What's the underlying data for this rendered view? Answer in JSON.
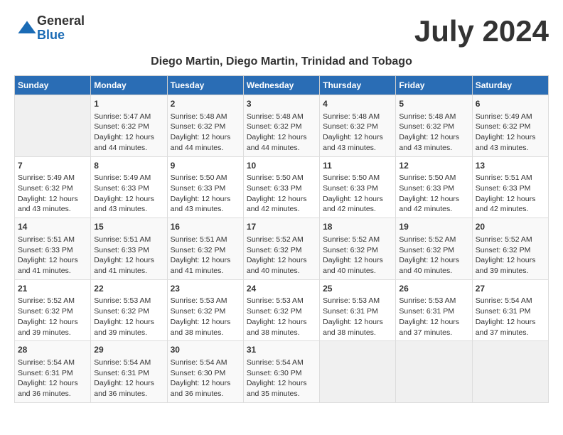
{
  "logo": {
    "general": "General",
    "blue": "Blue"
  },
  "title": "July 2024",
  "subtitle": "Diego Martin, Diego Martin, Trinidad and Tobago",
  "days_of_week": [
    "Sunday",
    "Monday",
    "Tuesday",
    "Wednesday",
    "Thursday",
    "Friday",
    "Saturday"
  ],
  "weeks": [
    [
      {
        "day": "",
        "info": ""
      },
      {
        "day": "1",
        "info": "Sunrise: 5:47 AM\nSunset: 6:32 PM\nDaylight: 12 hours\nand 44 minutes."
      },
      {
        "day": "2",
        "info": "Sunrise: 5:48 AM\nSunset: 6:32 PM\nDaylight: 12 hours\nand 44 minutes."
      },
      {
        "day": "3",
        "info": "Sunrise: 5:48 AM\nSunset: 6:32 PM\nDaylight: 12 hours\nand 44 minutes."
      },
      {
        "day": "4",
        "info": "Sunrise: 5:48 AM\nSunset: 6:32 PM\nDaylight: 12 hours\nand 43 minutes."
      },
      {
        "day": "5",
        "info": "Sunrise: 5:48 AM\nSunset: 6:32 PM\nDaylight: 12 hours\nand 43 minutes."
      },
      {
        "day": "6",
        "info": "Sunrise: 5:49 AM\nSunset: 6:32 PM\nDaylight: 12 hours\nand 43 minutes."
      }
    ],
    [
      {
        "day": "7",
        "info": "Sunrise: 5:49 AM\nSunset: 6:32 PM\nDaylight: 12 hours\nand 43 minutes."
      },
      {
        "day": "8",
        "info": "Sunrise: 5:49 AM\nSunset: 6:33 PM\nDaylight: 12 hours\nand 43 minutes."
      },
      {
        "day": "9",
        "info": "Sunrise: 5:50 AM\nSunset: 6:33 PM\nDaylight: 12 hours\nand 43 minutes."
      },
      {
        "day": "10",
        "info": "Sunrise: 5:50 AM\nSunset: 6:33 PM\nDaylight: 12 hours\nand 42 minutes."
      },
      {
        "day": "11",
        "info": "Sunrise: 5:50 AM\nSunset: 6:33 PM\nDaylight: 12 hours\nand 42 minutes."
      },
      {
        "day": "12",
        "info": "Sunrise: 5:50 AM\nSunset: 6:33 PM\nDaylight: 12 hours\nand 42 minutes."
      },
      {
        "day": "13",
        "info": "Sunrise: 5:51 AM\nSunset: 6:33 PM\nDaylight: 12 hours\nand 42 minutes."
      }
    ],
    [
      {
        "day": "14",
        "info": "Sunrise: 5:51 AM\nSunset: 6:33 PM\nDaylight: 12 hours\nand 41 minutes."
      },
      {
        "day": "15",
        "info": "Sunrise: 5:51 AM\nSunset: 6:33 PM\nDaylight: 12 hours\nand 41 minutes."
      },
      {
        "day": "16",
        "info": "Sunrise: 5:51 AM\nSunset: 6:32 PM\nDaylight: 12 hours\nand 41 minutes."
      },
      {
        "day": "17",
        "info": "Sunrise: 5:52 AM\nSunset: 6:32 PM\nDaylight: 12 hours\nand 40 minutes."
      },
      {
        "day": "18",
        "info": "Sunrise: 5:52 AM\nSunset: 6:32 PM\nDaylight: 12 hours\nand 40 minutes."
      },
      {
        "day": "19",
        "info": "Sunrise: 5:52 AM\nSunset: 6:32 PM\nDaylight: 12 hours\nand 40 minutes."
      },
      {
        "day": "20",
        "info": "Sunrise: 5:52 AM\nSunset: 6:32 PM\nDaylight: 12 hours\nand 39 minutes."
      }
    ],
    [
      {
        "day": "21",
        "info": "Sunrise: 5:52 AM\nSunset: 6:32 PM\nDaylight: 12 hours\nand 39 minutes."
      },
      {
        "day": "22",
        "info": "Sunrise: 5:53 AM\nSunset: 6:32 PM\nDaylight: 12 hours\nand 39 minutes."
      },
      {
        "day": "23",
        "info": "Sunrise: 5:53 AM\nSunset: 6:32 PM\nDaylight: 12 hours\nand 38 minutes."
      },
      {
        "day": "24",
        "info": "Sunrise: 5:53 AM\nSunset: 6:32 PM\nDaylight: 12 hours\nand 38 minutes."
      },
      {
        "day": "25",
        "info": "Sunrise: 5:53 AM\nSunset: 6:31 PM\nDaylight: 12 hours\nand 38 minutes."
      },
      {
        "day": "26",
        "info": "Sunrise: 5:53 AM\nSunset: 6:31 PM\nDaylight: 12 hours\nand 37 minutes."
      },
      {
        "day": "27",
        "info": "Sunrise: 5:54 AM\nSunset: 6:31 PM\nDaylight: 12 hours\nand 37 minutes."
      }
    ],
    [
      {
        "day": "28",
        "info": "Sunrise: 5:54 AM\nSunset: 6:31 PM\nDaylight: 12 hours\nand 36 minutes."
      },
      {
        "day": "29",
        "info": "Sunrise: 5:54 AM\nSunset: 6:31 PM\nDaylight: 12 hours\nand 36 minutes."
      },
      {
        "day": "30",
        "info": "Sunrise: 5:54 AM\nSunset: 6:30 PM\nDaylight: 12 hours\nand 36 minutes."
      },
      {
        "day": "31",
        "info": "Sunrise: 5:54 AM\nSunset: 6:30 PM\nDaylight: 12 hours\nand 35 minutes."
      },
      {
        "day": "",
        "info": ""
      },
      {
        "day": "",
        "info": ""
      },
      {
        "day": "",
        "info": ""
      }
    ]
  ]
}
